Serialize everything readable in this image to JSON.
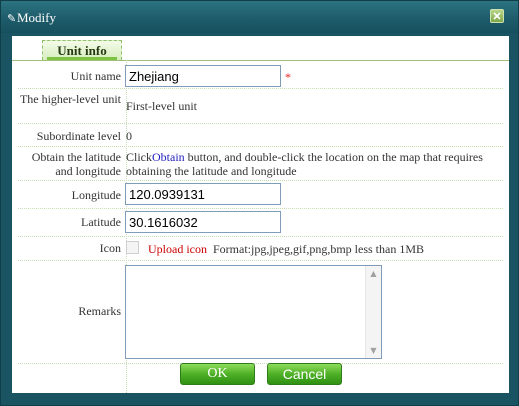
{
  "dialog": {
    "title": "Modify",
    "title_icon": "pencil-icon",
    "close_icon": "close-icon"
  },
  "tab": {
    "label": "Unit info"
  },
  "form": {
    "unit_name_label": "Unit name",
    "unit_name_value": "Zhejiang",
    "required_mark": "*",
    "higher_level_label": "The higher-level unit",
    "higher_level_value": "First-level unit",
    "subordinate_label": "Subordinate level",
    "subordinate_value": "0",
    "obtain_label": "Obtain the latitude and longitude",
    "obtain_prefix": "Click",
    "obtain_link": "Obtain",
    "obtain_suffix": " button, and double-click the location on the map that requires obtaining the latitude and longitude",
    "longitude_label": "Longitude",
    "longitude_value": "120.0939131",
    "latitude_label": "Latitude",
    "latitude_value": "30.1616032",
    "icon_label": "Icon",
    "upload_label": "Upload icon",
    "format_text": "Format:jpg,jpeg,gif,png,bmp less than 1MB",
    "remarks_label": "Remarks",
    "remarks_value": ""
  },
  "buttons": {
    "ok": "OK",
    "cancel": "Cancel"
  },
  "colors": {
    "titlebar": "#1e5c6b",
    "button": "#4fb127",
    "required": "#e02020",
    "upload": "#cc0000",
    "link": "#2020c0"
  }
}
